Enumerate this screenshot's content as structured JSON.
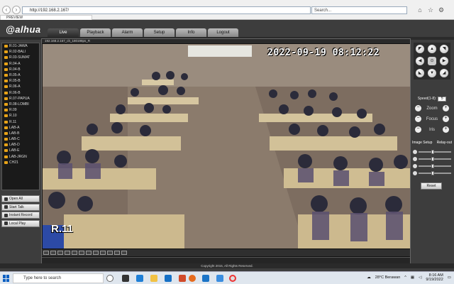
{
  "browser": {
    "url": "http://192.168.2.167/",
    "search_placeholder": "Search...",
    "tab_title": "PREVIEW"
  },
  "app": {
    "logo": "alhua",
    "nav_tabs": [
      "Live",
      "Playback",
      "Alarm",
      "Setup",
      "Info",
      "Logout"
    ],
    "active_tab": "Live",
    "channels": [
      "R.01-JAWA",
      "R.02-BALI",
      "R.03-SUMAT",
      "R.04-A",
      "R.04-B",
      "R.05-A",
      "R.05-B",
      "R.06-A",
      "R.06-B",
      "R.07-PAPUA",
      "R.08-LOMBI",
      "R.09",
      "R.10",
      "R.11",
      "LAB-A",
      "LAB-B",
      "LAB-C",
      "LAB-D",
      "LAB-E",
      "LAB-JRGN",
      "CH21"
    ],
    "side_buttons": [
      "Open All",
      "Start Talk",
      "Instant Record",
      "Local Play"
    ],
    "video_title": "192.168.2.167_ch_180198ps_R",
    "timestamp": "2022-09-19 08:12:22",
    "camera_label": "R.11",
    "ptz": {
      "speed_label": "Speed(1-8):",
      "speed_value": "5",
      "zoom_label": "Zoom",
      "focus_label": "Focus",
      "iris_label": "Iris"
    },
    "image_setup": {
      "label": "Image Setup",
      "relay_label": "Relay-out",
      "reset_label": "Reset"
    },
    "copyright": "Copyright 2015, All Rights Reserved."
  },
  "taskbar": {
    "search_placeholder": "Type here to search",
    "weather": "28°C  Berawan",
    "time": "8:16 AM",
    "date": "9/19/2022"
  },
  "colors": {
    "accent_red": "#cc0000",
    "camera_icon": "#e8a317",
    "windows_blue": "#0a5fc2"
  }
}
